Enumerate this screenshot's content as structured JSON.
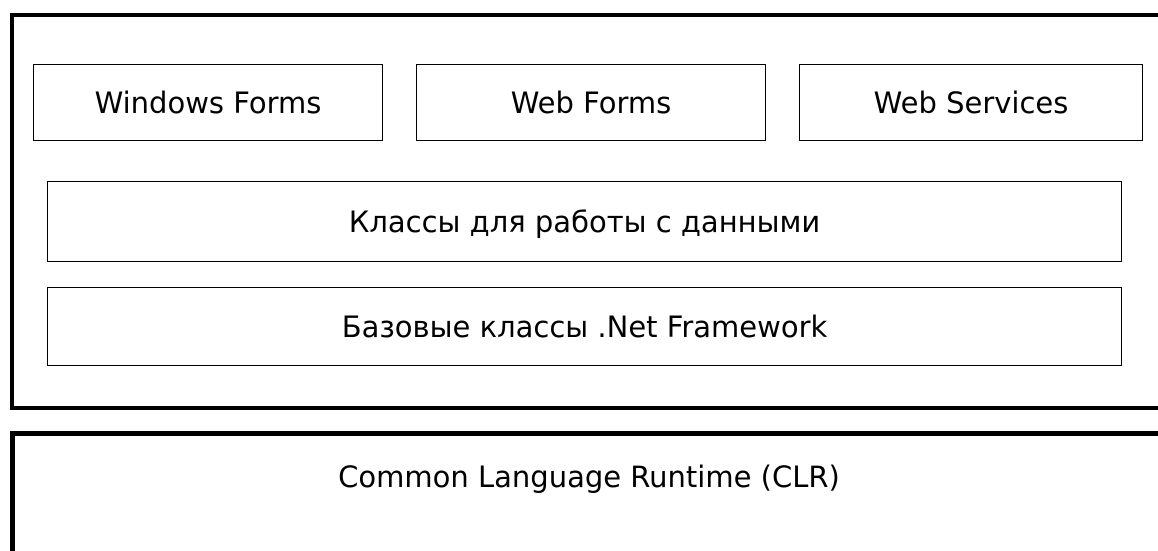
{
  "diagram": {
    "top_row": [
      {
        "id": "windows-forms",
        "label": "Windows Forms"
      },
      {
        "id": "web-forms",
        "label": "Web Forms"
      },
      {
        "id": "web-services",
        "label": "Web Services"
      }
    ],
    "data_classes": {
      "label": "Классы для работы с данными"
    },
    "base_classes": {
      "label": "Базовые классы .Net Framework"
    },
    "clr": {
      "label": "Common Language Runtime (CLR)"
    }
  }
}
